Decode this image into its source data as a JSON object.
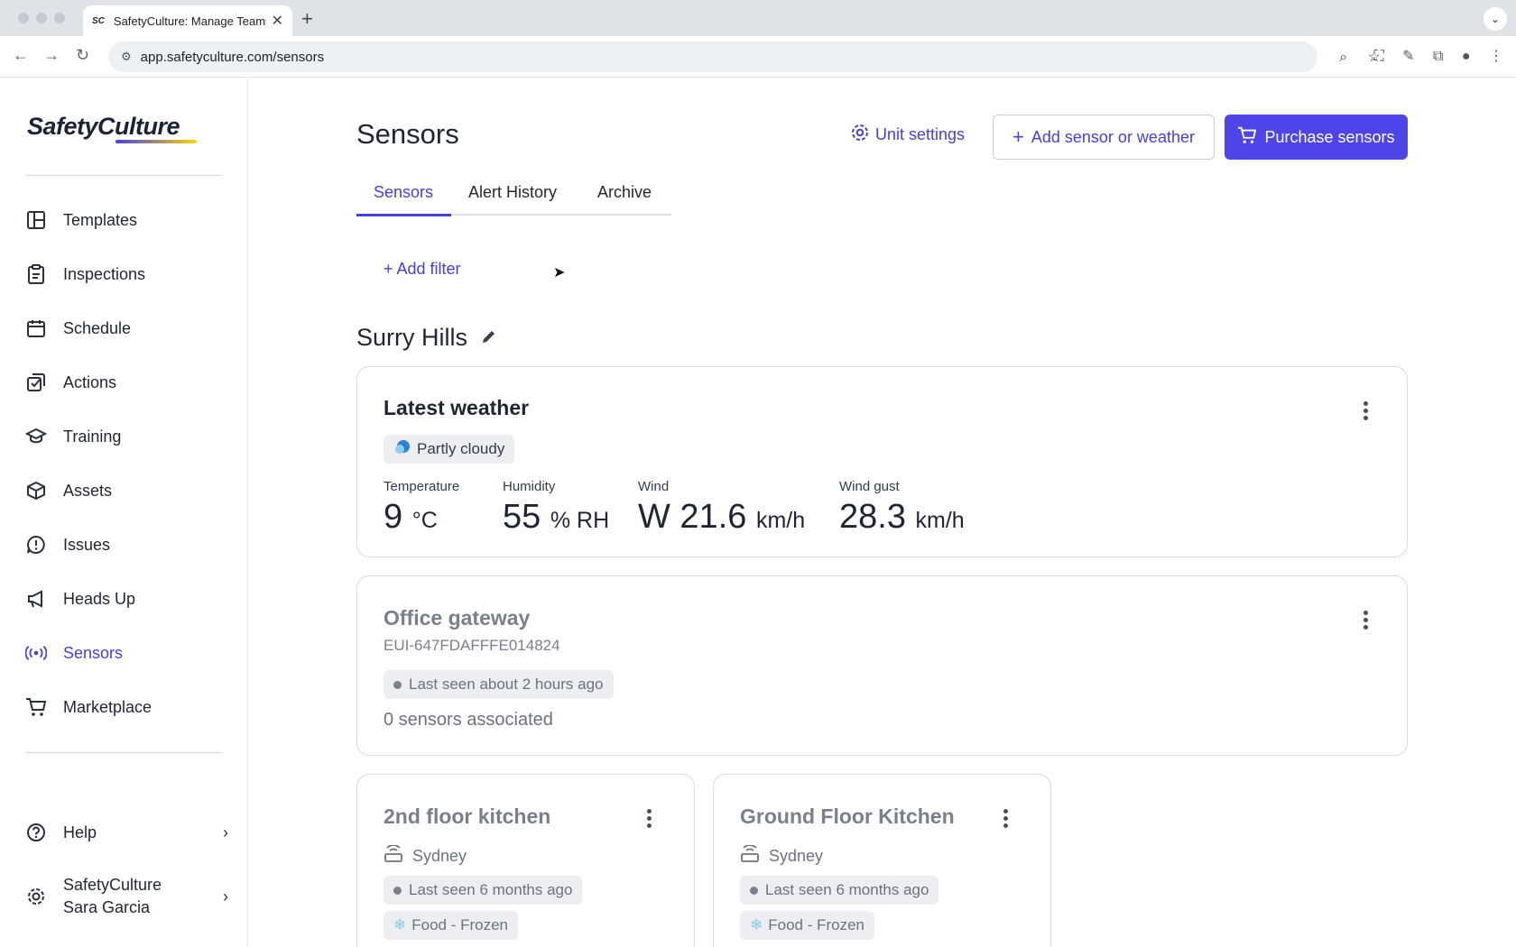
{
  "browser": {
    "tab_title": "SafetyCulture: Manage Teams",
    "favicon_text": "SC",
    "url": "app.safetyculture.com/sensors"
  },
  "sidebar": {
    "logo": "SafetyCulture",
    "items": [
      {
        "label": "Templates",
        "icon": "templates-icon"
      },
      {
        "label": "Inspections",
        "icon": "clipboard-icon"
      },
      {
        "label": "Schedule",
        "icon": "calendar-icon"
      },
      {
        "label": "Actions",
        "icon": "checkbox-icon"
      },
      {
        "label": "Training",
        "icon": "graduation-cap-icon"
      },
      {
        "label": "Assets",
        "icon": "cube-icon"
      },
      {
        "label": "Issues",
        "icon": "alert-bubble-icon"
      },
      {
        "label": "Heads Up",
        "icon": "megaphone-icon"
      },
      {
        "label": "Sensors",
        "icon": "broadcast-icon"
      },
      {
        "label": "Marketplace",
        "icon": "cart-icon"
      }
    ],
    "active": "Sensors",
    "help_label": "Help",
    "account_org": "SafetyCulture",
    "account_user": "Sara Garcia"
  },
  "header": {
    "title": "Sensors",
    "unit_settings": "Unit settings",
    "add_sensor": "Add sensor or weather",
    "purchase": "Purchase sensors"
  },
  "tabs": [
    {
      "label": "Sensors",
      "active": true
    },
    {
      "label": "Alert History",
      "active": false
    },
    {
      "label": "Archive",
      "active": false
    }
  ],
  "filter": {
    "add_label": "+ Add filter"
  },
  "site": {
    "name": "Surry Hills"
  },
  "weather": {
    "title": "Latest weather",
    "condition": "Partly cloudy",
    "metrics": [
      {
        "label": "Temperature",
        "value": "9",
        "unit": "°C"
      },
      {
        "label": "Humidity",
        "value": "55",
        "unit": "% RH"
      },
      {
        "label": "Wind",
        "value": "W 21.6",
        "unit": "km/h"
      },
      {
        "label": "Wind gust",
        "value": "28.3",
        "unit": "km/h"
      }
    ]
  },
  "gateway": {
    "title": "Office gateway",
    "eui": "EUI-647FDAFFFE014824",
    "status": "Last seen about 2 hours ago",
    "associated": "0 sensors associated"
  },
  "sensors": [
    {
      "title": "2nd floor kitchen",
      "location": "Sydney",
      "status": "Last seen 6 months ago",
      "category": "Food - Frozen"
    },
    {
      "title": "Ground Floor Kitchen",
      "location": "Sydney",
      "status": "Last seen 6 months ago",
      "category": "Food - Frozen"
    }
  ],
  "colors": {
    "accent": "#4740d4",
    "primary_button": "#4d45e8"
  }
}
